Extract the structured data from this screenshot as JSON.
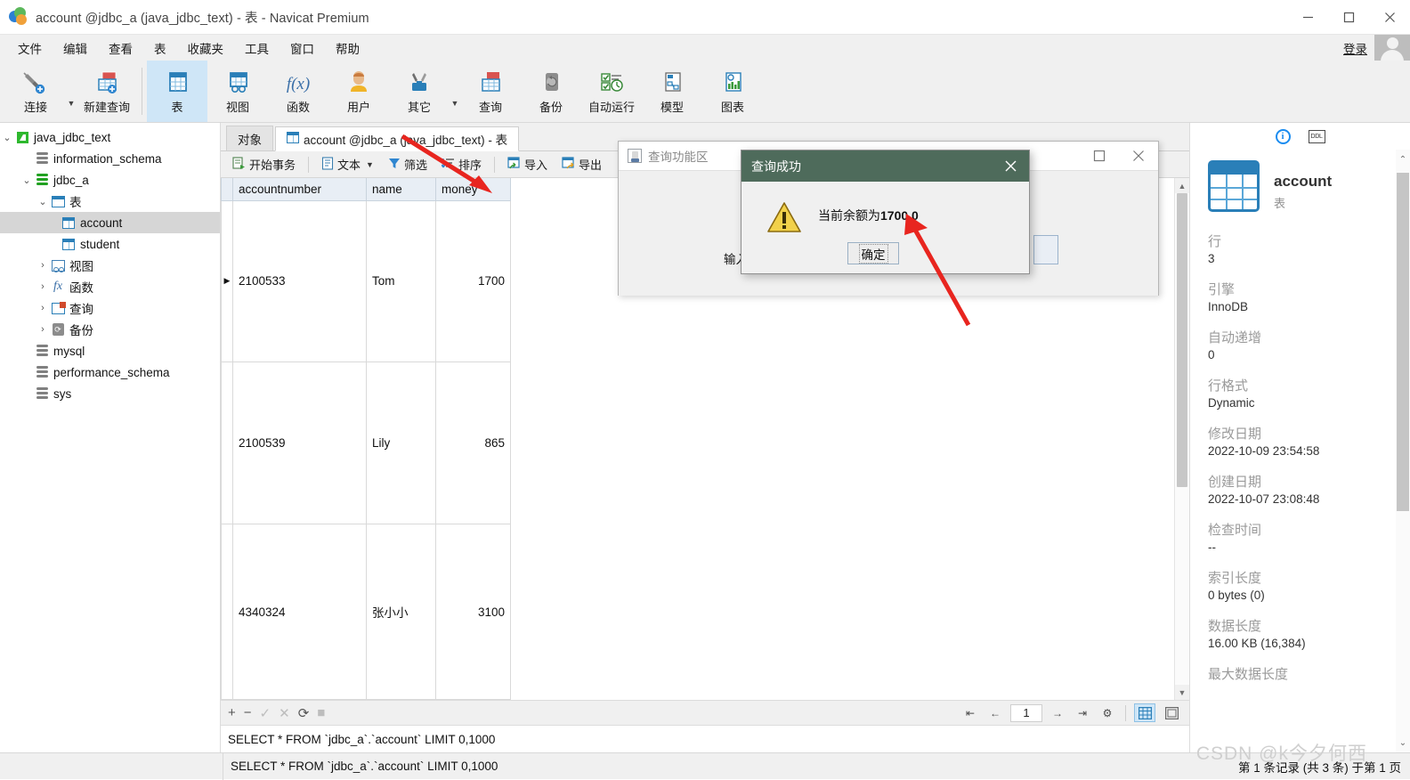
{
  "window": {
    "title": "account @jdbc_a (java_jdbc_text) - 表 - Navicat Premium",
    "minimize_label": "最小化",
    "maximize_label": "最大化",
    "close_label": "关闭"
  },
  "menubar": {
    "items": [
      {
        "label": "文件",
        "name": "menu-file"
      },
      {
        "label": "编辑",
        "name": "menu-edit"
      },
      {
        "label": "查看",
        "name": "menu-view"
      },
      {
        "label": "表",
        "name": "menu-table"
      },
      {
        "label": "收藏夹",
        "name": "menu-favorites"
      },
      {
        "label": "工具",
        "name": "menu-tools"
      },
      {
        "label": "窗口",
        "name": "menu-window"
      },
      {
        "label": "帮助",
        "name": "menu-help"
      }
    ],
    "login_label": "登录"
  },
  "ribbon": {
    "buttons": [
      {
        "label": "连接",
        "icon": "connection-icon",
        "active": false
      },
      {
        "label": "新建查询",
        "icon": "new-query-icon",
        "active": false
      },
      {
        "label": "表",
        "icon": "table-icon",
        "active": true
      },
      {
        "label": "视图",
        "icon": "view-icon",
        "active": false
      },
      {
        "label": "函数",
        "icon": "function-icon",
        "active": false
      },
      {
        "label": "用户",
        "icon": "user-icon",
        "active": false
      },
      {
        "label": "其它",
        "icon": "other-icon",
        "active": false
      },
      {
        "label": "查询",
        "icon": "query-icon",
        "active": false
      },
      {
        "label": "备份",
        "icon": "backup-icon",
        "active": false
      },
      {
        "label": "自动运行",
        "icon": "automation-icon",
        "active": false
      },
      {
        "label": "模型",
        "icon": "model-icon",
        "active": false
      },
      {
        "label": "图表",
        "icon": "chart-icon",
        "active": false
      }
    ]
  },
  "tree": {
    "nodes": [
      {
        "label": "java_jdbc_text",
        "icon": "connection-icon",
        "indent": 0,
        "twisty": "expanded",
        "selected": false
      },
      {
        "label": "information_schema",
        "icon": "database-icon",
        "indent": 1,
        "twisty": "none",
        "selected": false
      },
      {
        "label": "jdbc_a",
        "icon": "database-icon-green",
        "indent": 1,
        "twisty": "expanded",
        "selected": false
      },
      {
        "label": "表",
        "icon": "tables-folder-icon",
        "indent": 2,
        "twisty": "expanded",
        "selected": false
      },
      {
        "label": "account",
        "icon": "table-icon",
        "indent": 3,
        "twisty": "none",
        "selected": true
      },
      {
        "label": "student",
        "icon": "table-icon",
        "indent": 3,
        "twisty": "none",
        "selected": false
      },
      {
        "label": "视图",
        "icon": "views-folder-icon",
        "indent": 2,
        "twisty": "collapsed",
        "selected": false
      },
      {
        "label": "函数",
        "icon": "functions-folder-icon",
        "indent": 2,
        "twisty": "collapsed",
        "selected": false
      },
      {
        "label": "查询",
        "icon": "queries-folder-icon",
        "indent": 2,
        "twisty": "collapsed",
        "selected": false
      },
      {
        "label": "备份",
        "icon": "backups-folder-icon",
        "indent": 2,
        "twisty": "collapsed",
        "selected": false
      },
      {
        "label": "mysql",
        "icon": "database-icon",
        "indent": 1,
        "twisty": "none",
        "selected": false
      },
      {
        "label": "performance_schema",
        "icon": "database-icon",
        "indent": 1,
        "twisty": "none",
        "selected": false
      },
      {
        "label": "sys",
        "icon": "database-icon",
        "indent": 1,
        "twisty": "none",
        "selected": false
      }
    ]
  },
  "tabs": [
    {
      "label": "对象",
      "icon": "none",
      "active": false
    },
    {
      "label": "account @jdbc_a (java_jdbc_text) - 表",
      "icon": "table-icon",
      "active": true
    }
  ],
  "grid_toolbar": {
    "buttons": [
      {
        "label": "开始事务",
        "icon": "transaction-icon",
        "caret": false
      },
      {
        "label": "文本",
        "icon": "text-icon",
        "caret": true
      },
      {
        "label": "筛选",
        "icon": "filter-icon",
        "caret": false
      },
      {
        "label": "排序",
        "icon": "sort-icon",
        "caret": false
      },
      {
        "label": "导入",
        "icon": "import-icon",
        "caret": false
      },
      {
        "label": "导出",
        "icon": "export-icon",
        "caret": false
      }
    ]
  },
  "datagrid": {
    "columns": [
      "accountnumber",
      "name",
      "money"
    ],
    "rows": [
      {
        "marker": "current",
        "accountnumber": "2100533",
        "name": "Tom",
        "money": "1700"
      },
      {
        "marker": "",
        "accountnumber": "2100539",
        "name": "Lily",
        "money": "865"
      },
      {
        "marker": "",
        "accountnumber": "4340324",
        "name": "张小小",
        "money": "3100"
      }
    ]
  },
  "grid_footer": {
    "actions": [
      {
        "name": "add-record-button",
        "glyph": "+",
        "enabled": true
      },
      {
        "name": "delete-record-button",
        "glyph": "−",
        "enabled": true
      },
      {
        "name": "apply-change-button",
        "glyph": "✓",
        "enabled": false
      },
      {
        "name": "cancel-change-button",
        "glyph": "✕",
        "enabled": false
      },
      {
        "name": "refresh-button",
        "glyph": "⟳",
        "enabled": true
      },
      {
        "name": "stop-button",
        "glyph": "■",
        "enabled": false
      }
    ],
    "pager": {
      "first_label": "⇤",
      "prev_label": "←",
      "page_value": "1",
      "next_label": "→",
      "last_label": "⇥",
      "settings_label": "⚙",
      "grid_view_label": "网格视图",
      "form_view_label": "表单视图"
    }
  },
  "sql_preview": "SELECT * FROM `jdbc_a`.`account` LIMIT 0,1000",
  "status_bar": {
    "sql": "SELECT * FROM `jdbc_a`.`account` LIMIT 0,1000",
    "record_info": "第 1 条记录 (共 3 条) 于第 1 页"
  },
  "info_panel": {
    "tab_info_label": "信息",
    "tab_ddl_label": "DDL",
    "object_name": "account",
    "object_type": "表",
    "fields": [
      {
        "key": "行",
        "value": "3"
      },
      {
        "key": "引擎",
        "value": "InnoDB"
      },
      {
        "key": "自动递增",
        "value": "0"
      },
      {
        "key": "行格式",
        "value": "Dynamic"
      },
      {
        "key": "修改日期",
        "value": "2022-10-09 23:54:58"
      },
      {
        "key": "创建日期",
        "value": "2022-10-07 23:08:48"
      },
      {
        "key": "检查时间",
        "value": "--"
      },
      {
        "key": "索引长度",
        "value": "0 bytes (0)"
      },
      {
        "key": "数据长度",
        "value": "16.00 KB (16,384)"
      },
      {
        "key": "最大数据长度",
        "value": ""
      }
    ]
  },
  "java_window": {
    "title": "查询功能区",
    "field_label": "输入",
    "input_value": "",
    "maximize_label": "最大化",
    "close_label": "关闭"
  },
  "message_dialog": {
    "title": "查询成功",
    "message_prefix": "当前余额为",
    "message_value": "1700.0",
    "ok_label": "确定",
    "close_label": "关闭",
    "title_bg": "#4e6b5b",
    "icon": "warning-icon"
  },
  "watermark": "CSDN @k今夕何西",
  "colors": {
    "accent": "#2a7fb8",
    "ribbon_active": "#cfe6f7",
    "dialog_title": "#4e6b5b",
    "annotation_arrow": "#e8251f",
    "header_bg": "#e8eef5"
  }
}
